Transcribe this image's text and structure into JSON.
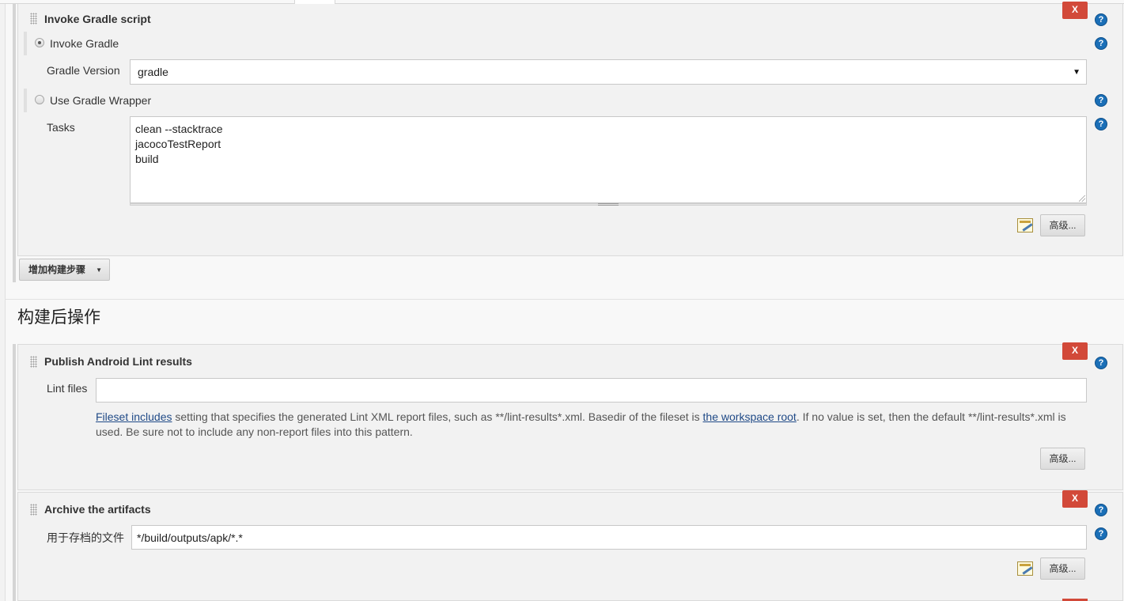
{
  "gradle_section": {
    "title": "Invoke Gradle script",
    "delete_label": "X",
    "invoke_gradle_label": "Invoke Gradle",
    "gradle_version_label": "Gradle Version",
    "gradle_version_value": "gradle",
    "use_wrapper_label": "Use Gradle Wrapper",
    "tasks_label": "Tasks",
    "tasks_lines": [
      "clean --stacktrace",
      "jacocoTestReport",
      "build"
    ],
    "advanced_label": "高级..."
  },
  "add_build_step_label": "增加构建步骤",
  "post_build_heading": "构建后操作",
  "lint_section": {
    "title": "Publish Android Lint results",
    "delete_label": "X",
    "lint_files_label": "Lint files",
    "lint_files_value": "",
    "desc_link1": "Fileset includes",
    "desc_text1": " setting that specifies the generated Lint XML report files, such as **/lint-results*.xml. Basedir of the fileset is ",
    "desc_link2": "the workspace root",
    "desc_text2": ". If no value is set, then the default **/lint-results*.xml is",
    "desc_line2": "used. Be sure not to include any non-report files into this pattern.",
    "advanced_label": "高级..."
  },
  "archive_section": {
    "title": "Archive the artifacts",
    "delete_label": "X",
    "files_label": "用于存档的文件",
    "files_value": "*/build/outputs/apk/*.*",
    "advanced_label": "高级..."
  },
  "help_glyph": "?",
  "icons": [
    "drag-handle-icon",
    "help-icon",
    "notepad-icon",
    "dropdown-arrow-icon"
  ],
  "colors": {
    "delete": "#d24939",
    "help": "#1b6fb7",
    "link": "#204a87"
  }
}
